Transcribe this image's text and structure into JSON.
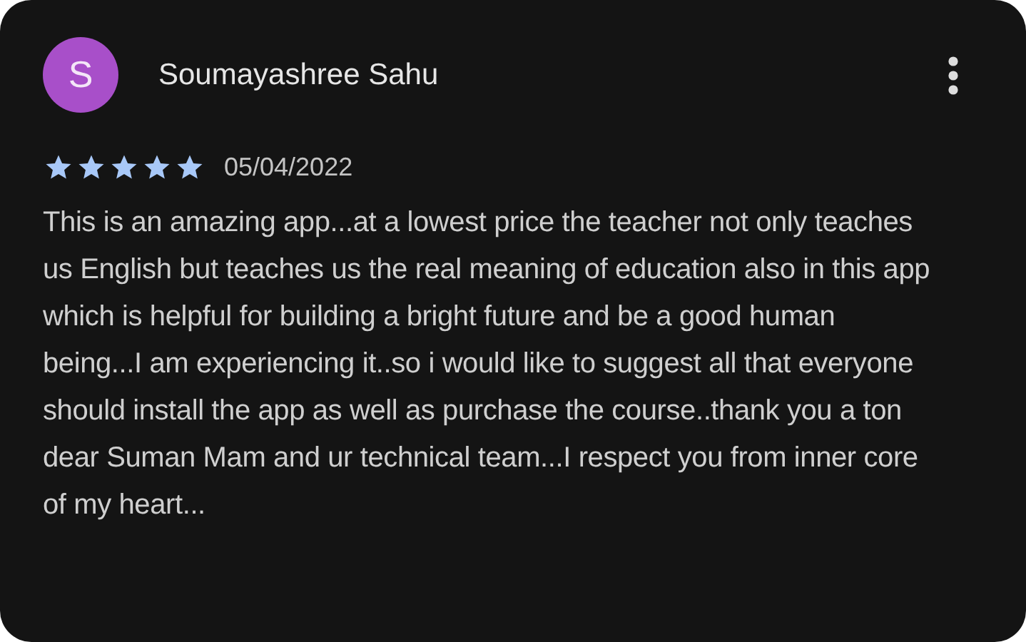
{
  "review": {
    "avatar_letter": "S",
    "author": "Soumayashree Sahu",
    "stars": 5,
    "date": "05/04/2022",
    "text": "This is an amazing app...at a lowest price the teacher not only teaches us English but teaches us the real meaning of education also in this app which is helpful for building a bright future and be a good human being...I am experiencing it..so i would like to suggest all that everyone should install the app as well as purchase the course..thank you a ton dear Suman Mam and ur technical team...I respect you from inner core of my heart..."
  }
}
